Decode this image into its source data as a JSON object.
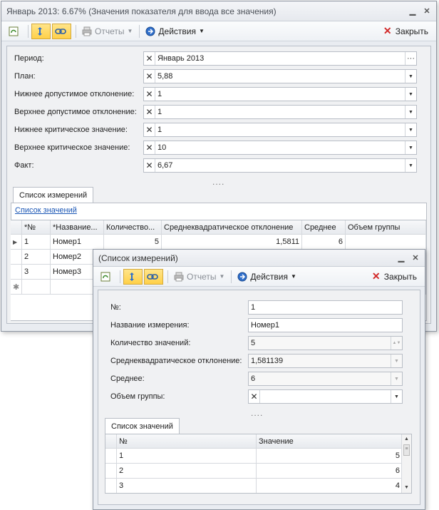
{
  "main": {
    "title": "Январь 2013: 6.67% (Значения показателя для ввода все значения)",
    "toolbar": {
      "reports": "Отчеты",
      "actions": "Действия",
      "close": "Закрыть"
    },
    "fields": [
      {
        "label": "Период:",
        "value": "Январь 2013"
      },
      {
        "label": "План:",
        "value": "5,88"
      },
      {
        "label": "Нижнее допустимое отклонение:",
        "value": "1"
      },
      {
        "label": "Верхнее допустимое отклонение:",
        "value": "1"
      },
      {
        "label": "Нижнее критическое значение:",
        "value": "1"
      },
      {
        "label": "Верхнее критическое значение:",
        "value": "10"
      },
      {
        "label": "Факт:",
        "value": "6,67"
      }
    ],
    "dots": "....",
    "tab": "Список измерений",
    "link": "Список значений",
    "grid": {
      "headers": [
        "*№",
        "*Название...",
        "Количество...",
        "Среднеквадратическое отклонение",
        "Среднее",
        "Объем группы"
      ],
      "rows": [
        [
          "1",
          "Номер1",
          "5",
          "1,5811",
          "6",
          ""
        ],
        [
          "2",
          "Номер2",
          "",
          "",
          "",
          ""
        ],
        [
          "3",
          "Номер3",
          "",
          "",
          "",
          ""
        ]
      ],
      "new_row_marker": "✱"
    }
  },
  "popup": {
    "title": "(Список измерений)",
    "toolbar": {
      "reports": "Отчеты",
      "actions": "Действия",
      "close": "Закрыть"
    },
    "fields": [
      {
        "label": "№:",
        "value": "1"
      },
      {
        "label": "Название измерения:",
        "value": "Номер1"
      },
      {
        "label": "Количество значений:",
        "value": "5"
      },
      {
        "label": "Среднеквадратическое отклонение:",
        "value": "1,581139"
      },
      {
        "label": "Среднее:",
        "value": "6"
      },
      {
        "label": "Объем группы:",
        "value": ""
      }
    ],
    "dots": "....",
    "tab": "Список значений",
    "grid": {
      "headers": [
        "№",
        "Значение"
      ],
      "rows": [
        [
          "1",
          "5"
        ],
        [
          "2",
          "6"
        ],
        [
          "3",
          "4"
        ]
      ]
    }
  },
  "colors": {
    "accent": "#1a56b5",
    "close_x": "#d22a2a",
    "highlight": "#ffd048"
  }
}
